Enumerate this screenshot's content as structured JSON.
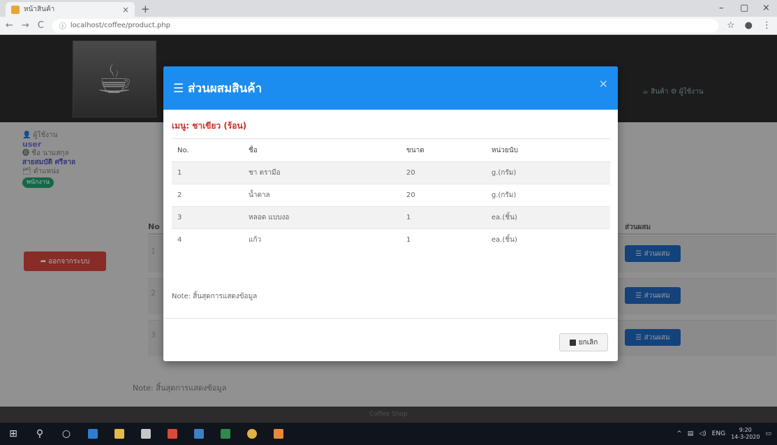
{
  "browser": {
    "tab_title": "หน้าสินค้า",
    "tab_close": "×",
    "new_tab": "+",
    "url": "localhost/coffee/product.php",
    "win_minimize": "–",
    "win_maximize": "▢",
    "win_close": "×"
  },
  "site": {
    "nav_links": "☕ สินค้า  ⚙ ผู้ใช้งาน",
    "sidebar": {
      "user_role_label": "👤 ผู้ใช้งาน",
      "user_role_value": "user",
      "name_label": "⓿ ชื่อ นามสกุล",
      "name_value": "สายสมบัติ ศรีลาล",
      "position_label": "🗂 ตำแหน่ง",
      "position_value": "พนักงาน",
      "logout_label": "➦ ออกจากระบบ"
    },
    "table_header_no": "No",
    "table_header_ingredients": "ส่วนผสม",
    "row_buttons": "☰ ส่วนผสม",
    "rows": [
      {
        "no": "1"
      },
      {
        "no": "2"
      },
      {
        "no": "3"
      }
    ],
    "note": "Note: สิ้นสุดการแสดงข้อมูล",
    "footer": "Coffee Shop"
  },
  "modal": {
    "title": "☰ ส่วนผสมสินค้า",
    "close": "×",
    "menu_label": "เมนู: ชาเขียว (ร้อน)",
    "columns": [
      "No.",
      "ชื่อ",
      "ขนาด",
      "หน่วยนับ"
    ],
    "rows": [
      {
        "no": "1",
        "name": "ชา ตรามือ",
        "size": "20",
        "unit": "g.(กรัม)"
      },
      {
        "no": "2",
        "name": "น้ำตาล",
        "size": "20",
        "unit": "g.(กรัม)"
      },
      {
        "no": "3",
        "name": "หลอด แบบงอ",
        "size": "1",
        "unit": "ea.(ชิ้น)"
      },
      {
        "no": "4",
        "name": "แก้ว",
        "size": "1",
        "unit": "ea.(ชิ้น)"
      }
    ],
    "note": "Note: สิ้นสุดการแสดงข้อมูล",
    "cancel_label": "ยกเลิก"
  },
  "taskbar": {
    "tray_lang": "ENG",
    "time": "9:20",
    "date": "14-3-2020"
  }
}
